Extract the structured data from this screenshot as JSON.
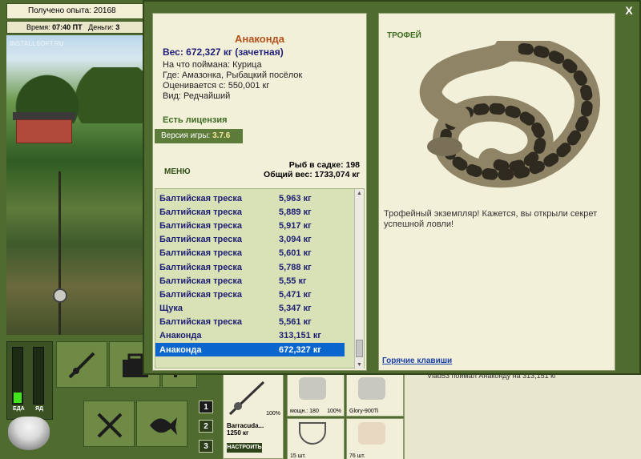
{
  "status": {
    "experience_label": "Получено опыта:",
    "experience_value": "20168",
    "time_label": "Время:",
    "time_value": "07:40 ПТ",
    "money_label": "Деньги:",
    "money_value": "3"
  },
  "watermark": "INSTALLSOFT.RU",
  "catch": {
    "title": "Анаконда",
    "weight_line": "Вес: 672,327 кг (зачетная)",
    "bait_line": "На что поймана: Курица",
    "place_line": "Где: Амазонка, Рыбацкий посёлок",
    "value_line": "Оценивается с: 550,001 кг",
    "kind_line": "Вид: Редчайший"
  },
  "license": "Есть лицензия",
  "version_label": "Версия игры:",
  "version_value": "3.7.6",
  "menu_label": "МЕНЮ",
  "cage": {
    "fish_line": "Рыб в садке: 198",
    "total_line": "Общий вес: 1733,074 кг"
  },
  "fish_list": [
    {
      "name": "Балтийская треска",
      "weight": "5,963 кг"
    },
    {
      "name": "Балтийская треска",
      "weight": "5,889 кг"
    },
    {
      "name": "Балтийская треска",
      "weight": "5,917 кг"
    },
    {
      "name": "Балтийская треска",
      "weight": "3,094 кг"
    },
    {
      "name": "Балтийская треска",
      "weight": "5,601 кг"
    },
    {
      "name": "Балтийская треска",
      "weight": "5,788 кг"
    },
    {
      "name": "Балтийская треска",
      "weight": "5,55 кг"
    },
    {
      "name": "Балтийская треска",
      "weight": "5,471 кг"
    },
    {
      "name": "Щука",
      "weight": "5,347 кг"
    },
    {
      "name": "Балтийская треска",
      "weight": "5,561 кг"
    },
    {
      "name": "Анаконда",
      "weight": "313,151 кг"
    },
    {
      "name": "Анаконда",
      "weight": "672,327 кг"
    }
  ],
  "selected_index": 11,
  "trophy": {
    "label": "ТРОФЕЙ",
    "text": "Трофейный экземпляр! Кажется, вы открыли секрет успешной ловли!",
    "hotkeys": "Горячие клавиши"
  },
  "close_label": "X",
  "meters": {
    "food_label": "ЕДА",
    "bait_label": "ЯД",
    "food_level": 0.18,
    "bait_level": 0.0
  },
  "tab_buttons": [
    "1",
    "2",
    "3"
  ],
  "rod": {
    "name": "Barracuda...",
    "weight": "1250 кг",
    "durability": "100%",
    "setup_label": "НАСТРОИТЬ"
  },
  "slots": [
    {
      "caption": "мощн.: 180",
      "percent": "100%"
    },
    {
      "caption": "Glory-900Ti",
      "percent": ""
    },
    {
      "caption": "15 шт.",
      "percent": ""
    },
    {
      "caption": "76 шт.",
      "percent": ""
    }
  ],
  "log_message": "Vlad53 поймал Анаконду на 313,151 кг",
  "colors": {
    "frame_green": "#4f6b30",
    "panel_cream": "#f3f0d9",
    "title_orange": "#b3521c",
    "list_navy": "#1d1f74",
    "selection_blue": "#0a66cc"
  }
}
